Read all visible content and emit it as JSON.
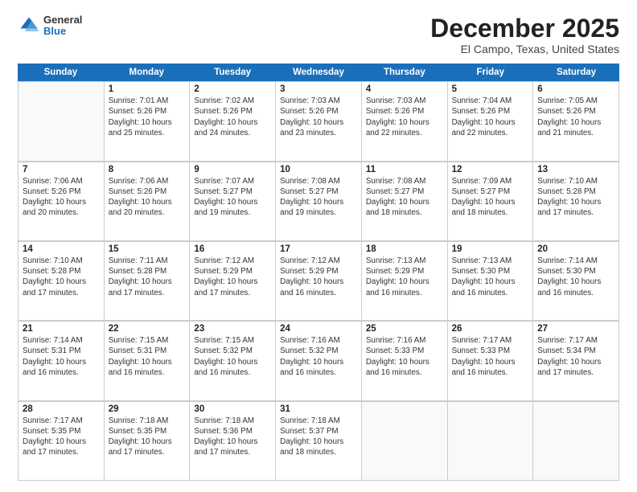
{
  "logo": {
    "general": "General",
    "blue": "Blue"
  },
  "title": "December 2025",
  "subtitle": "El Campo, Texas, United States",
  "headers": [
    "Sunday",
    "Monday",
    "Tuesday",
    "Wednesday",
    "Thursday",
    "Friday",
    "Saturday"
  ],
  "weeks": [
    [
      {
        "day": null
      },
      {
        "day": "1",
        "sunrise": "Sunrise: 7:01 AM",
        "sunset": "Sunset: 5:26 PM",
        "daylight": "Daylight: 10 hours and 25 minutes."
      },
      {
        "day": "2",
        "sunrise": "Sunrise: 7:02 AM",
        "sunset": "Sunset: 5:26 PM",
        "daylight": "Daylight: 10 hours and 24 minutes."
      },
      {
        "day": "3",
        "sunrise": "Sunrise: 7:03 AM",
        "sunset": "Sunset: 5:26 PM",
        "daylight": "Daylight: 10 hours and 23 minutes."
      },
      {
        "day": "4",
        "sunrise": "Sunrise: 7:03 AM",
        "sunset": "Sunset: 5:26 PM",
        "daylight": "Daylight: 10 hours and 22 minutes."
      },
      {
        "day": "5",
        "sunrise": "Sunrise: 7:04 AM",
        "sunset": "Sunset: 5:26 PM",
        "daylight": "Daylight: 10 hours and 22 minutes."
      },
      {
        "day": "6",
        "sunrise": "Sunrise: 7:05 AM",
        "sunset": "Sunset: 5:26 PM",
        "daylight": "Daylight: 10 hours and 21 minutes."
      }
    ],
    [
      {
        "day": "7",
        "sunrise": "Sunrise: 7:06 AM",
        "sunset": "Sunset: 5:26 PM",
        "daylight": "Daylight: 10 hours and 20 minutes."
      },
      {
        "day": "8",
        "sunrise": "Sunrise: 7:06 AM",
        "sunset": "Sunset: 5:26 PM",
        "daylight": "Daylight: 10 hours and 20 minutes."
      },
      {
        "day": "9",
        "sunrise": "Sunrise: 7:07 AM",
        "sunset": "Sunset: 5:27 PM",
        "daylight": "Daylight: 10 hours and 19 minutes."
      },
      {
        "day": "10",
        "sunrise": "Sunrise: 7:08 AM",
        "sunset": "Sunset: 5:27 PM",
        "daylight": "Daylight: 10 hours and 19 minutes."
      },
      {
        "day": "11",
        "sunrise": "Sunrise: 7:08 AM",
        "sunset": "Sunset: 5:27 PM",
        "daylight": "Daylight: 10 hours and 18 minutes."
      },
      {
        "day": "12",
        "sunrise": "Sunrise: 7:09 AM",
        "sunset": "Sunset: 5:27 PM",
        "daylight": "Daylight: 10 hours and 18 minutes."
      },
      {
        "day": "13",
        "sunrise": "Sunrise: 7:10 AM",
        "sunset": "Sunset: 5:28 PM",
        "daylight": "Daylight: 10 hours and 17 minutes."
      }
    ],
    [
      {
        "day": "14",
        "sunrise": "Sunrise: 7:10 AM",
        "sunset": "Sunset: 5:28 PM",
        "daylight": "Daylight: 10 hours and 17 minutes."
      },
      {
        "day": "15",
        "sunrise": "Sunrise: 7:11 AM",
        "sunset": "Sunset: 5:28 PM",
        "daylight": "Daylight: 10 hours and 17 minutes."
      },
      {
        "day": "16",
        "sunrise": "Sunrise: 7:12 AM",
        "sunset": "Sunset: 5:29 PM",
        "daylight": "Daylight: 10 hours and 17 minutes."
      },
      {
        "day": "17",
        "sunrise": "Sunrise: 7:12 AM",
        "sunset": "Sunset: 5:29 PM",
        "daylight": "Daylight: 10 hours and 16 minutes."
      },
      {
        "day": "18",
        "sunrise": "Sunrise: 7:13 AM",
        "sunset": "Sunset: 5:29 PM",
        "daylight": "Daylight: 10 hours and 16 minutes."
      },
      {
        "day": "19",
        "sunrise": "Sunrise: 7:13 AM",
        "sunset": "Sunset: 5:30 PM",
        "daylight": "Daylight: 10 hours and 16 minutes."
      },
      {
        "day": "20",
        "sunrise": "Sunrise: 7:14 AM",
        "sunset": "Sunset: 5:30 PM",
        "daylight": "Daylight: 10 hours and 16 minutes."
      }
    ],
    [
      {
        "day": "21",
        "sunrise": "Sunrise: 7:14 AM",
        "sunset": "Sunset: 5:31 PM",
        "daylight": "Daylight: 10 hours and 16 minutes."
      },
      {
        "day": "22",
        "sunrise": "Sunrise: 7:15 AM",
        "sunset": "Sunset: 5:31 PM",
        "daylight": "Daylight: 10 hours and 16 minutes."
      },
      {
        "day": "23",
        "sunrise": "Sunrise: 7:15 AM",
        "sunset": "Sunset: 5:32 PM",
        "daylight": "Daylight: 10 hours and 16 minutes."
      },
      {
        "day": "24",
        "sunrise": "Sunrise: 7:16 AM",
        "sunset": "Sunset: 5:32 PM",
        "daylight": "Daylight: 10 hours and 16 minutes."
      },
      {
        "day": "25",
        "sunrise": "Sunrise: 7:16 AM",
        "sunset": "Sunset: 5:33 PM",
        "daylight": "Daylight: 10 hours and 16 minutes."
      },
      {
        "day": "26",
        "sunrise": "Sunrise: 7:17 AM",
        "sunset": "Sunset: 5:33 PM",
        "daylight": "Daylight: 10 hours and 16 minutes."
      },
      {
        "day": "27",
        "sunrise": "Sunrise: 7:17 AM",
        "sunset": "Sunset: 5:34 PM",
        "daylight": "Daylight: 10 hours and 17 minutes."
      }
    ],
    [
      {
        "day": "28",
        "sunrise": "Sunrise: 7:17 AM",
        "sunset": "Sunset: 5:35 PM",
        "daylight": "Daylight: 10 hours and 17 minutes."
      },
      {
        "day": "29",
        "sunrise": "Sunrise: 7:18 AM",
        "sunset": "Sunset: 5:35 PM",
        "daylight": "Daylight: 10 hours and 17 minutes."
      },
      {
        "day": "30",
        "sunrise": "Sunrise: 7:18 AM",
        "sunset": "Sunset: 5:36 PM",
        "daylight": "Daylight: 10 hours and 17 minutes."
      },
      {
        "day": "31",
        "sunrise": "Sunrise: 7:18 AM",
        "sunset": "Sunset: 5:37 PM",
        "daylight": "Daylight: 10 hours and 18 minutes."
      },
      {
        "day": null
      },
      {
        "day": null
      },
      {
        "day": null
      }
    ]
  ]
}
